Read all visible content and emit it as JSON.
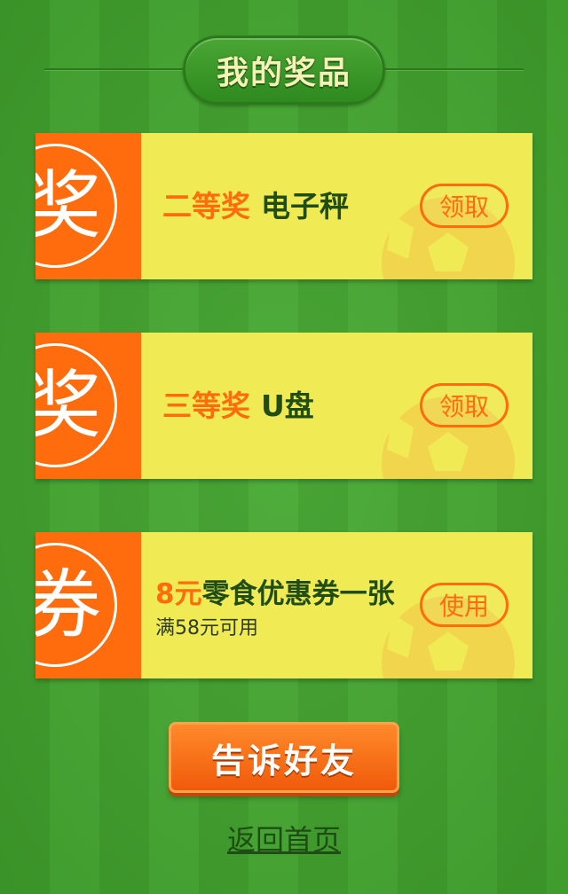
{
  "title": "我的奖品",
  "prizes": [
    {
      "badge": "奖",
      "rank": "二等奖",
      "name": "电子秤",
      "action": "领取"
    },
    {
      "badge": "奖",
      "rank": "三等奖",
      "name": "U盘",
      "action": "领取"
    }
  ],
  "coupon": {
    "badge": "券",
    "amount": "8元",
    "description": "零食优惠券一张",
    "condition": "满58元可用",
    "action": "使用"
  },
  "share_button": "告诉好友",
  "home_link": "返回首页",
  "colors": {
    "field_green": "#3f9f2b",
    "ticket_orange": "#fe6c0d",
    "ticket_yellow": "#f0ea54",
    "text_dark_green": "#1f4d14"
  }
}
